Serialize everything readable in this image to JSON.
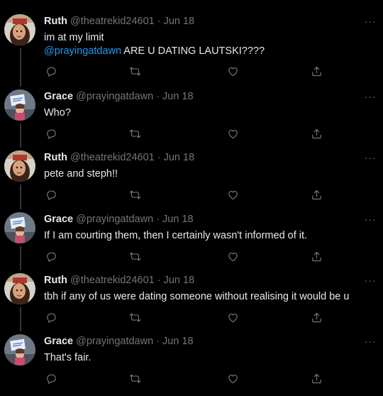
{
  "users": {
    "ruth": {
      "name": "Ruth",
      "handle": "@theatrekid24601"
    },
    "grace": {
      "name": "Grace",
      "handle": "@prayingatdawn"
    }
  },
  "tweets": [
    {
      "user": "ruth",
      "name": "Ruth",
      "handle": "@theatrekid24601",
      "sep": "·",
      "date": "Jun 18",
      "line1": "im at my limit",
      "mention": "@prayingatdawn",
      "line2": " ARE U DATING LAUTSKI????"
    },
    {
      "user": "grace",
      "name": "Grace",
      "handle": "@prayingatdawn",
      "sep": "·",
      "date": "Jun 18",
      "text": "Who?"
    },
    {
      "user": "ruth",
      "name": "Ruth",
      "handle": "@theatrekid24601",
      "sep": "·",
      "date": "Jun 18",
      "text": "pete and steph!!"
    },
    {
      "user": "grace",
      "name": "Grace",
      "handle": "@prayingatdawn",
      "sep": "·",
      "date": "Jun 18",
      "text": "If I am courting them, then I certainly wasn't informed of it."
    },
    {
      "user": "ruth",
      "name": "Ruth",
      "handle": "@theatrekid24601",
      "sep": "·",
      "date": "Jun 18",
      "text": "tbh if any of us were dating someone without realising it would be u"
    },
    {
      "user": "grace",
      "name": "Grace",
      "handle": "@prayingatdawn",
      "sep": "·",
      "date": "Jun 18",
      "text": "That's fair."
    }
  ],
  "icons": {
    "more": "more-icon",
    "reply": "reply-icon",
    "retweet": "retweet-icon",
    "like": "like-icon",
    "share": "share-icon"
  },
  "colors": {
    "background": "#000000",
    "text": "#e7e9ea",
    "secondary": "#71767b",
    "mention": "#1d9bf0",
    "thread_line": "#333639"
  },
  "more_glyph": "···"
}
